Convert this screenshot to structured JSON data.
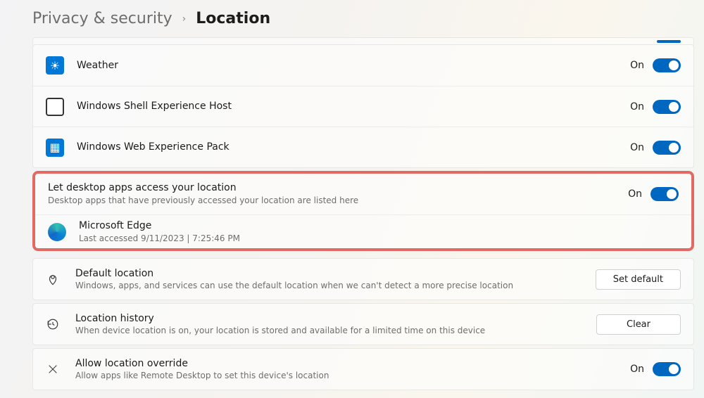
{
  "breadcrumb": {
    "parent": "Privacy & security",
    "current": "Location"
  },
  "apps": [
    {
      "name": "Weather",
      "state": "On",
      "icon": "weather"
    },
    {
      "name": "Windows Shell Experience Host",
      "state": "On",
      "icon": "shell"
    },
    {
      "name": "Windows Web Experience Pack",
      "state": "On",
      "icon": "web"
    }
  ],
  "desktop_section": {
    "title": "Let desktop apps access your location",
    "subtitle": "Desktop apps that have previously accessed your location are listed here",
    "state": "On",
    "app": {
      "name": "Microsoft Edge",
      "last_accessed": "Last accessed 9/11/2023  |  7:25:46 PM"
    }
  },
  "default_location": {
    "title": "Default location",
    "subtitle": "Windows, apps, and services can use the default location when we can't detect a more precise location",
    "button": "Set default"
  },
  "history": {
    "title": "Location history",
    "subtitle": "When device location is on, your location is stored and available for a limited time on this device",
    "button": "Clear"
  },
  "override": {
    "title": "Allow location override",
    "subtitle": "Allow apps like Remote Desktop to set this device's location",
    "state": "On"
  }
}
